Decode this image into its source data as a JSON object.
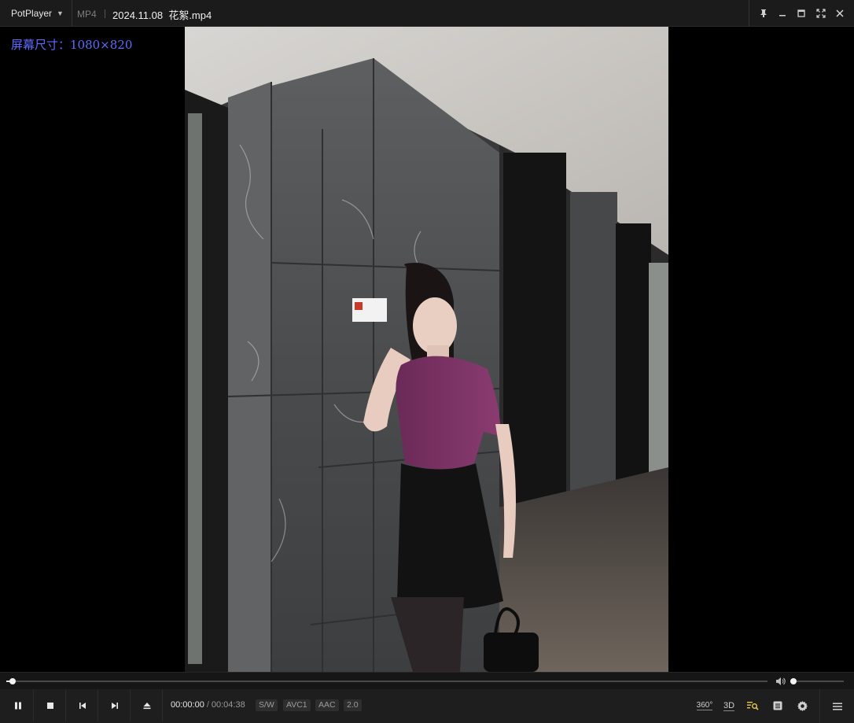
{
  "titlebar": {
    "app_name": "PotPlayer",
    "format": "MP4",
    "filename": "2024.11.08  花絮.mp4",
    "icons": [
      "pin-icon",
      "minimize-icon",
      "maximize-icon",
      "fullscreen-icon",
      "close-icon"
    ]
  },
  "overlay": {
    "text": "屏幕尺寸：1080×820"
  },
  "playback": {
    "progress": 0.008,
    "volume": 0.06
  },
  "controls": {
    "buttons": [
      "pause-icon",
      "stop-icon",
      "previous-icon",
      "next-icon",
      "eject-icon"
    ],
    "current_time": "00:00:00",
    "separator": "/",
    "duration": "00:04:38",
    "badges": {
      "render": "S/W",
      "video_codec": "AVC1",
      "audio_codec": "AAC",
      "channels": "2.0"
    },
    "right_labels": {
      "vr": "360°",
      "stereo": "3D"
    }
  },
  "colors": {
    "overlay_text": "#5d6bff",
    "accent_playlist": "#e7c84a",
    "bar_bg": "#1e1e1e"
  }
}
